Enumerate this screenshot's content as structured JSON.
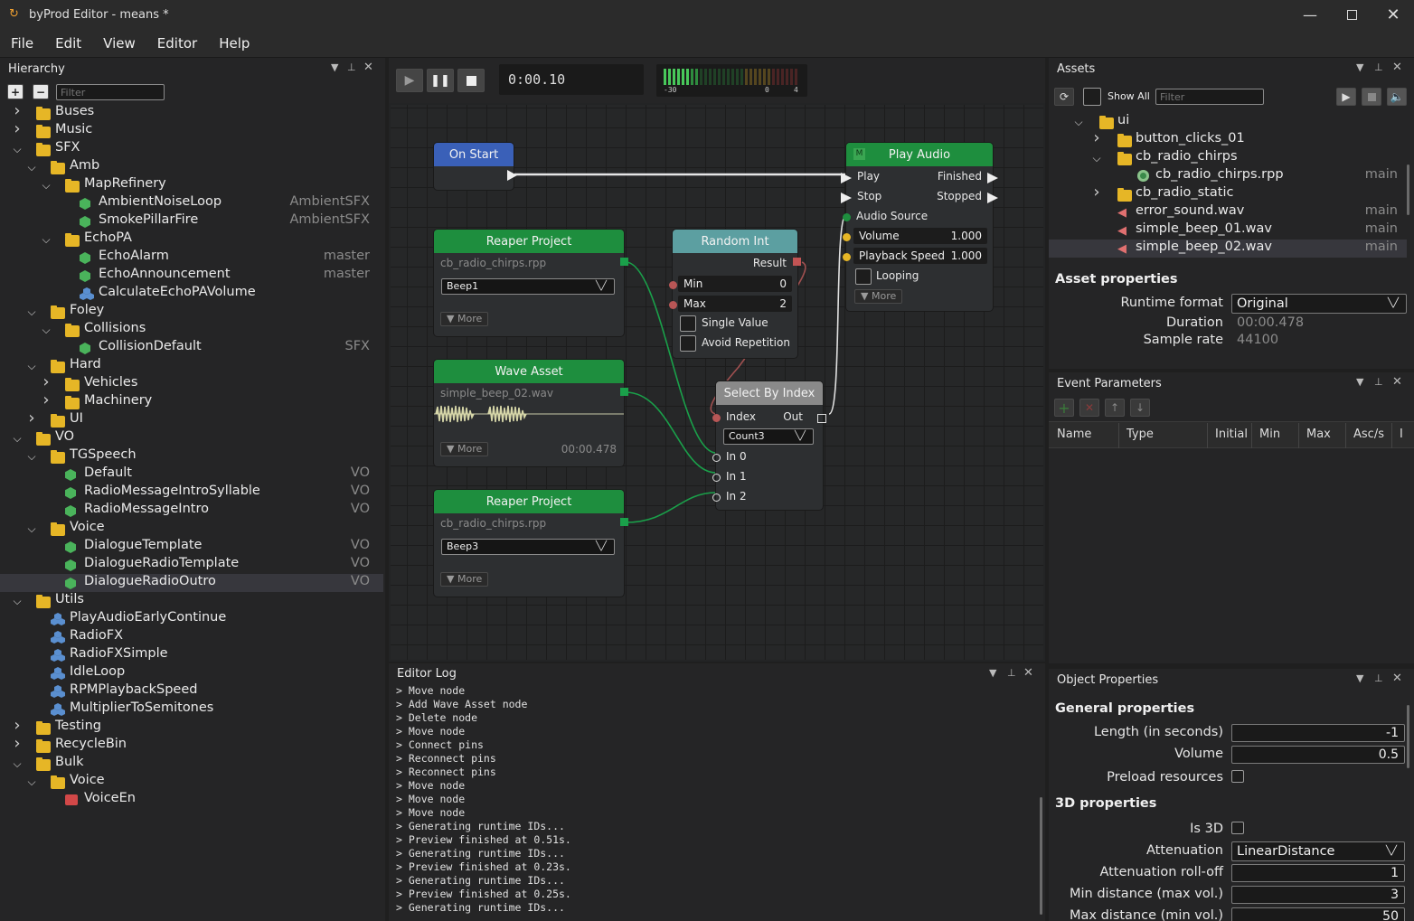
{
  "window": {
    "title": "byProd Editor - means *"
  },
  "menu": [
    "File",
    "Edit",
    "View",
    "Editor",
    "Help"
  ],
  "hierarchy": {
    "title": "Hierarchy",
    "filter_placeholder": "Filter",
    "rows": [
      {
        "label": "Buses",
        "icon": "folder-icon",
        "tag": ""
      },
      {
        "label": "Music",
        "icon": "folder-icon",
        "tag": ""
      },
      {
        "label": "SFX",
        "icon": "folder-icon",
        "tag": ""
      },
      {
        "label": "Amb",
        "icon": "folder-icon",
        "tag": ""
      },
      {
        "label": "MapRefinery",
        "icon": "folder-icon",
        "tag": ""
      },
      {
        "label": "AmbientNoiseLoop",
        "icon": "event-icon",
        "tag": "AmbientSFX"
      },
      {
        "label": "SmokePillarFire",
        "icon": "event-icon",
        "tag": "AmbientSFX"
      },
      {
        "label": "EchoPA",
        "icon": "folder-icon",
        "tag": ""
      },
      {
        "label": "EchoAlarm",
        "icon": "event-icon",
        "tag": "master"
      },
      {
        "label": "EchoAnnouncement",
        "icon": "event-icon",
        "tag": "master"
      },
      {
        "label": "CalculateEchoPAVolume",
        "icon": "function-icon",
        "tag": ""
      },
      {
        "label": "Foley",
        "icon": "folder-icon",
        "tag": ""
      },
      {
        "label": "Collisions",
        "icon": "folder-icon",
        "tag": ""
      },
      {
        "label": "CollisionDefault",
        "icon": "event-icon",
        "tag": "SFX"
      },
      {
        "label": "Hard",
        "icon": "folder-icon",
        "tag": ""
      },
      {
        "label": "Vehicles",
        "icon": "folder-icon",
        "tag": ""
      },
      {
        "label": "Machinery",
        "icon": "folder-icon",
        "tag": ""
      },
      {
        "label": "UI",
        "icon": "folder-icon",
        "tag": ""
      },
      {
        "label": "VO",
        "icon": "folder-icon",
        "tag": ""
      },
      {
        "label": "TGSpeech",
        "icon": "folder-icon",
        "tag": ""
      },
      {
        "label": "Default",
        "icon": "event-icon",
        "tag": "VO"
      },
      {
        "label": "RadioMessageIntroSyllable",
        "icon": "event-icon",
        "tag": "VO"
      },
      {
        "label": "RadioMessageIntro",
        "icon": "event-icon",
        "tag": "VO"
      },
      {
        "label": "Voice",
        "icon": "folder-icon",
        "tag": ""
      },
      {
        "label": "DialogueTemplate",
        "icon": "event-icon",
        "tag": "VO"
      },
      {
        "label": "DialogueRadioTemplate",
        "icon": "event-icon",
        "tag": "VO"
      },
      {
        "label": "DialogueRadioOutro",
        "icon": "event-icon",
        "tag": "VO"
      },
      {
        "label": "Utils",
        "icon": "folder-icon",
        "tag": ""
      },
      {
        "label": "PlayAudioEarlyContinue",
        "icon": "function-icon",
        "tag": ""
      },
      {
        "label": "RadioFX",
        "icon": "function-icon",
        "tag": ""
      },
      {
        "label": "RadioFXSimple",
        "icon": "function-icon",
        "tag": ""
      },
      {
        "label": "IdleLoop",
        "icon": "function-icon",
        "tag": ""
      },
      {
        "label": "RPMPlaybackSpeed",
        "icon": "function-icon",
        "tag": ""
      },
      {
        "label": "MultiplierToSemitones",
        "icon": "function-icon",
        "tag": ""
      },
      {
        "label": "Testing",
        "icon": "folder-icon",
        "tag": ""
      },
      {
        "label": "RecycleBin",
        "icon": "folder-icon",
        "tag": ""
      },
      {
        "label": "Bulk",
        "icon": "folder-icon",
        "tag": ""
      },
      {
        "label": "Voice",
        "icon": "folder-icon",
        "tag": ""
      },
      {
        "label": "VoiceEn",
        "icon": "bank-icon",
        "tag": ""
      }
    ]
  },
  "transport": {
    "time": "0:00.10",
    "meter_labels": [
      "-30",
      "0",
      "4"
    ]
  },
  "graph": {
    "on_start": {
      "title": "On Start"
    },
    "play_audio": {
      "title": "Play Audio",
      "badge": "M",
      "play": "Play",
      "finished": "Finished",
      "stop": "Stop",
      "stopped": "Stopped",
      "audio_source": "Audio Source",
      "volume_label": "Volume",
      "volume": "1.000",
      "speed_label": "Playback Speed",
      "speed": "1.000",
      "looping": "Looping",
      "more": "More"
    },
    "reaper1": {
      "title": "Reaper Project",
      "file": "cb_radio_chirps.rpp",
      "select": "Beep1",
      "more": "More"
    },
    "random_int": {
      "title": "Random Int",
      "result": "Result",
      "min_label": "Min",
      "min": "0",
      "max_label": "Max",
      "max": "2",
      "single": "Single Value",
      "avoid": "Avoid Repetition"
    },
    "wave": {
      "title": "Wave Asset",
      "file": "simple_beep_02.wav",
      "duration": "00:00.478",
      "more": "More"
    },
    "select": {
      "title": "Select By Index",
      "index": "Index",
      "out": "Out",
      "dropdown": "Count3",
      "in0": "In 0",
      "in1": "In 1",
      "in2": "In 2"
    },
    "reaper2": {
      "title": "Reaper Project",
      "file": "cb_radio_chirps.rpp",
      "select": "Beep3",
      "more": "More"
    }
  },
  "log": {
    "title": "Editor Log",
    "lines": [
      "> Move node",
      "> Add Wave Asset node",
      "> Delete node",
      "> Move node",
      "> Connect pins",
      "> Reconnect pins",
      "> Reconnect pins",
      "> Move node",
      "> Move node",
      "> Move node",
      "> Generating runtime IDs...",
      "> Preview finished at 0.51s.",
      "> Generating runtime IDs...",
      "> Preview finished at 0.23s.",
      "> Generating runtime IDs...",
      "> Preview finished at 0.25s.",
      "> Generating runtime IDs..."
    ]
  },
  "assets": {
    "title": "Assets",
    "show_all": "Show All",
    "filter_placeholder": "Filter",
    "rows": [
      {
        "label": "ui",
        "icon": "folder-icon",
        "tag": ""
      },
      {
        "label": "button_clicks_01",
        "icon": "folder-icon",
        "tag": ""
      },
      {
        "label": "cb_radio_chirps",
        "icon": "folder-icon",
        "tag": ""
      },
      {
        "label": "cb_radio_chirps.rpp",
        "icon": "reaper-icon",
        "tag": "main"
      },
      {
        "label": "cb_radio_static",
        "icon": "folder-icon",
        "tag": ""
      },
      {
        "label": "error_sound.wav",
        "icon": "speaker-icon",
        "tag": "main"
      },
      {
        "label": "simple_beep_01.wav",
        "icon": "speaker-icon",
        "tag": "main"
      },
      {
        "label": "simple_beep_02.wav",
        "icon": "speaker-icon",
        "tag": "main"
      }
    ],
    "props_title": "Asset properties",
    "runtime_format_label": "Runtime format",
    "runtime_format": "Original",
    "duration_label": "Duration",
    "duration": "00:00.478",
    "sample_rate_label": "Sample rate",
    "sample_rate": "44100"
  },
  "event_params": {
    "title": "Event Parameters",
    "columns": [
      "Name",
      "Type",
      "Initial",
      "Min",
      "Max",
      "Asc/s",
      "I"
    ]
  },
  "object_props": {
    "title": "Object Properties",
    "general": "General properties",
    "length_label": "Length (in seconds)",
    "length": "-1",
    "volume_label": "Volume",
    "volume": "0.5",
    "preload_label": "Preload resources",
    "props3d": "3D properties",
    "is3d_label": "Is 3D",
    "attenuation_label": "Attenuation",
    "attenuation": "LinearDistance",
    "rolloff_label": "Attenuation roll-off",
    "rolloff": "1",
    "mindist_label": "Min distance (max vol.)",
    "mindist": "3",
    "maxdist_label": "Max distance (min vol.)",
    "maxdist": "50"
  },
  "colors": {
    "accent_green": "#1e8e3e",
    "node_blue": "#3a60b8",
    "node_teal": "#5c9fa1",
    "node_gray": "#8a8a8a",
    "folder": "#e6b626"
  }
}
